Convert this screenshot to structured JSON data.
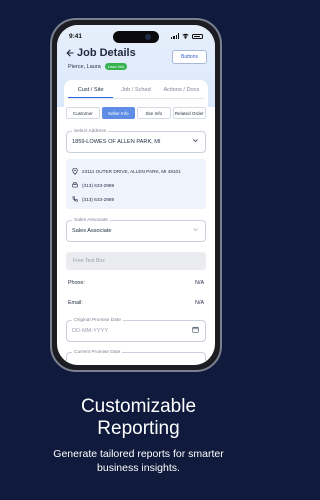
{
  "status_bar": {
    "time": "9:41"
  },
  "header": {
    "back_icon": "arrow-left-icon",
    "title": "Job Details",
    "buttons_label": "Buttons",
    "customer_name": "Pierce, Laura",
    "badge": "Lead Info"
  },
  "tabs": [
    "Cust / Site",
    "Job / Sched",
    "Actions / Docs"
  ],
  "subtabs": [
    "Customer",
    "Seller Info",
    "Site Info",
    "Related Order"
  ],
  "select_address": {
    "legend": "Select Address",
    "value": "1859-LOWES OF ALLEN PARK, MI"
  },
  "store": {
    "address": "23111 OUTER DRIVE, ALLEN PARK, MI 48101",
    "fax": "(313) 633-2989",
    "phone": "(313) 633-2989"
  },
  "sales_associate": {
    "legend": "Sales Associate",
    "value": "Sales Associate"
  },
  "free_text_placeholder": "Free Text Box",
  "phone": {
    "label": "Phone:",
    "value": "N/A"
  },
  "email": {
    "label": "Email:",
    "value": "N/A"
  },
  "original_promise_date": {
    "legend": "Original Promise Date",
    "placeholder": "DD-MM-YYYY"
  },
  "current_promise_date": {
    "legend": "Current Promise Date"
  },
  "caption": {
    "title_line1": "Customizable",
    "title_line2": "Reporting",
    "sub_line1": "Generate tailored reports for smarter",
    "sub_line2": "business insights."
  },
  "colors": {
    "background": "#0f1a3c",
    "accent": "#2f6be5",
    "active_subtab": "#5f8de6",
    "badge_green": "#33b24e"
  }
}
